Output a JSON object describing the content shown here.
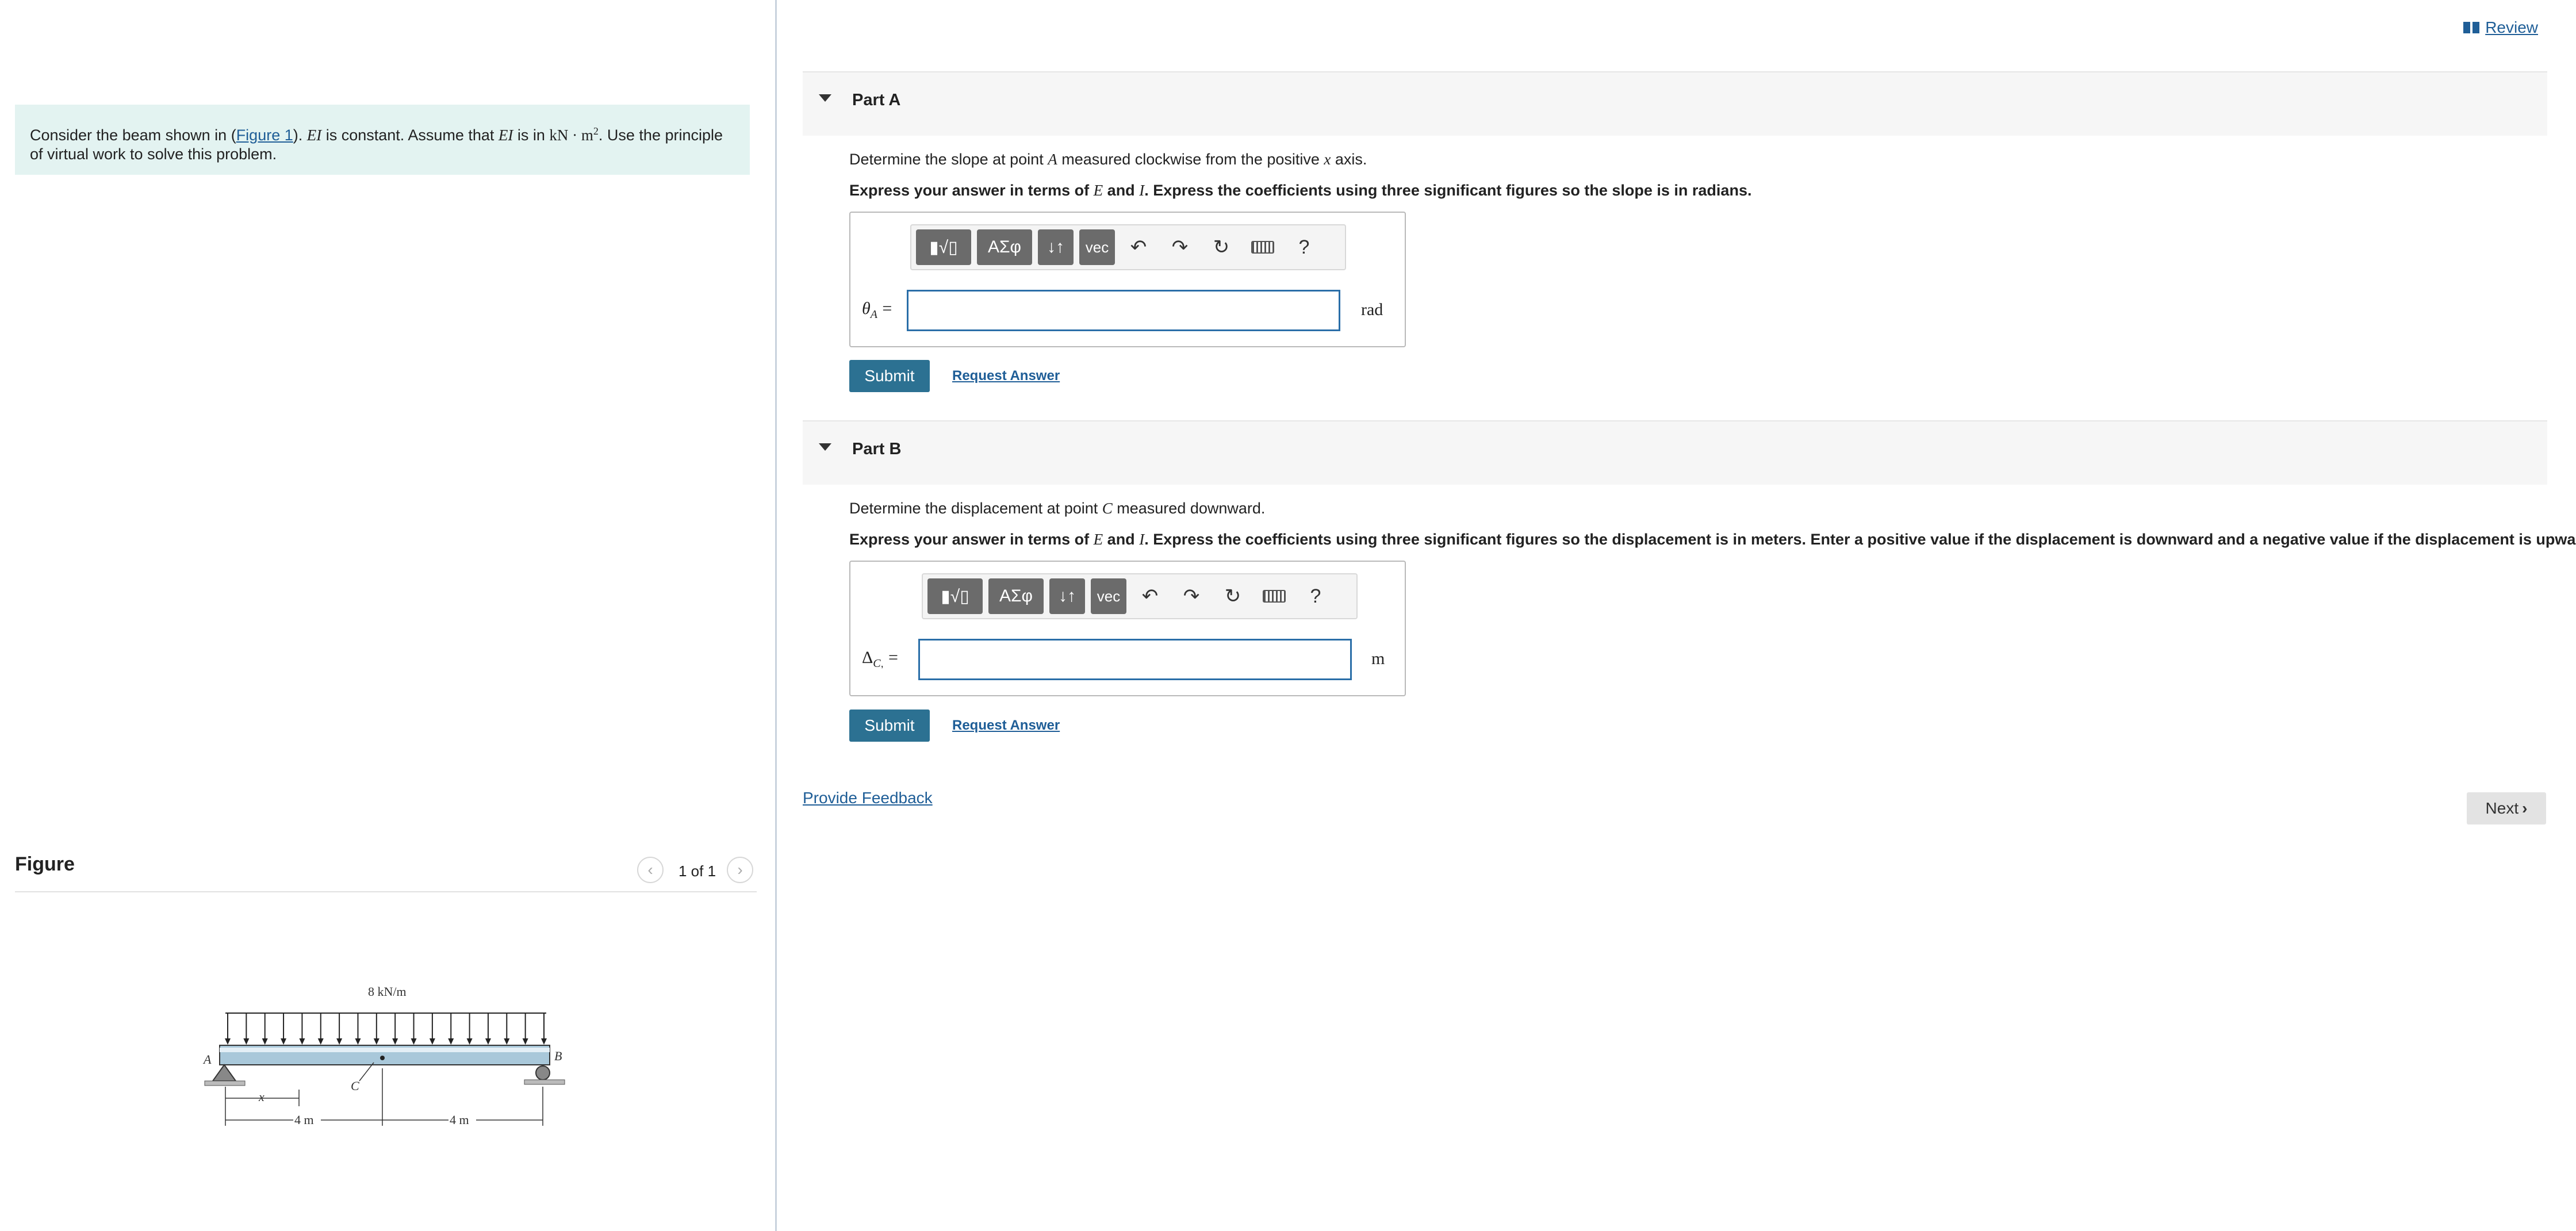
{
  "header": {
    "review_label": "Review",
    "review_icon": "book-icon"
  },
  "problem": {
    "text_before_link": "Consider the beam shown in (",
    "figure_link": "Figure 1",
    "text_middle": "). ",
    "EI_symbol": "EI",
    "text_ei_constant": " is constant. Assume that ",
    "text_is_in": " is in ",
    "units": "kN · m",
    "units_exp": "2",
    "text_after": ". Use the principle of virtual work to solve this problem."
  },
  "figure": {
    "heading": "Figure",
    "counter": "1 of 1",
    "load_label": "8 kN/m",
    "label_A": "A",
    "label_B": "B",
    "label_C": "C",
    "label_x": "x",
    "dim_left": "4 m",
    "dim_right": "4 m"
  },
  "parts": [
    {
      "title": "Part A",
      "prompt_1_pre": "Determine the slope at point ",
      "prompt_1_sym": "A",
      "prompt_1_mid": " measured clockwise from the positive ",
      "prompt_1_sym2": "x",
      "prompt_1_post": " axis.",
      "prompt_2_pre": "Express your answer in terms of ",
      "prompt_2_E": "E",
      "prompt_2_and": " and ",
      "prompt_2_I": "I",
      "prompt_2_post": ". Express the coefficients using three significant figures so the slope is in radians.",
      "answer_symbol": "θ",
      "answer_sub": "A",
      "answer_eq": "=",
      "answer_value": "",
      "unit": "rad",
      "submit_label": "Submit",
      "request_label": "Request Answer"
    },
    {
      "title": "Part B",
      "prompt_1_pre": "Determine the displacement at point ",
      "prompt_1_sym": "C",
      "prompt_1_post": " measured downward.",
      "prompt_2_pre": "Express your answer in terms of ",
      "prompt_2_E": "E",
      "prompt_2_and": " and ",
      "prompt_2_I": "I",
      "prompt_2_post": ". Express the coefficients using three significant figures so the displacement is in meters. Enter a positive value if the displacement is downward and a negative value if the displacement is upward.",
      "answer_symbol": "Δ",
      "answer_sub": "C",
      "answer_sub_post": ",",
      "answer_eq": "=",
      "answer_value": "",
      "unit": "m",
      "submit_label": "Submit",
      "request_label": "Request Answer"
    }
  ],
  "toolbar": {
    "templates_icon": "radical-template-icon",
    "greek_label": "ΑΣφ",
    "arrows_label": "↓↑",
    "vec_label": "vec",
    "help_label": "?"
  },
  "footer": {
    "feedback_label": "Provide Feedback",
    "next_label": "Next"
  }
}
